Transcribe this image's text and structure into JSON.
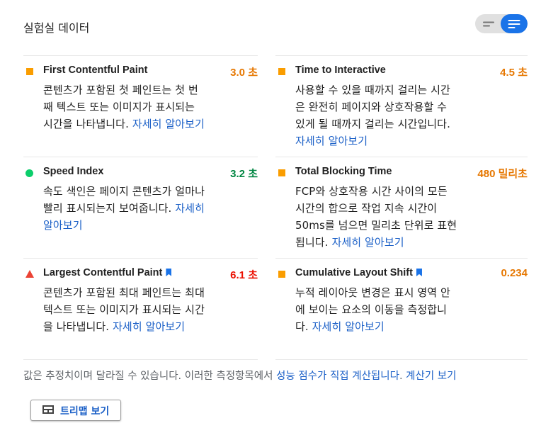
{
  "section_title": "실험실 데이터",
  "colors": {
    "accent": "#1a73e8",
    "pass": "#0cce6b",
    "average": "#fa9d00",
    "fail": "#eb4335",
    "link": "#1a5fc7"
  },
  "metrics": [
    {
      "name": "First Contentful Paint",
      "value": "3.0 초",
      "rating": "average",
      "icon": "orange-square-icon",
      "description": "콘텐츠가 포함된 첫 페인트는 첫 번째 텍스트 또는 이미지가 표시되는 시간을 나타냅니다.",
      "link": "자세히 알아보기"
    },
    {
      "name": "Time to Interactive",
      "value": "4.5 초",
      "rating": "average",
      "icon": "orange-square-icon",
      "description": "사용할 수 있을 때까지 걸리는 시간은 완전히 페이지와 상호작용할 수 있게 될 때까지 걸리는 시간입니다.",
      "link": "자세히 알아보기"
    },
    {
      "name": "Speed Index",
      "value": "3.2 초",
      "rating": "pass",
      "icon": "green-circle-icon",
      "description": "속도 색인은 페이지 콘텐츠가 얼마나 빨리 표시되는지 보여줍니다.",
      "link": "자세히 알아보기"
    },
    {
      "name": "Total Blocking Time",
      "value": "480 밀리초",
      "rating": "average",
      "icon": "orange-square-icon",
      "description": "FCP와 상호작용 시간 사이의 모든 시간의 합으로 작업 지속 시간이 50ms를 넘으면 밀리초 단위로 표현됩니다.",
      "link": "자세히 알아보기"
    },
    {
      "name": "Largest Contentful Paint",
      "value": "6.1 초",
      "rating": "fail",
      "icon": "red-triangle-icon",
      "description": "콘텐츠가 포함된 최대 페인트는 최대 텍스트 또는 이미지가 표시되는 시간을 나타냅니다.",
      "link": "자세히 알아보기"
    },
    {
      "name": "Cumulative Layout Shift",
      "value": "0.234",
      "rating": "average",
      "icon": "orange-square-icon",
      "description": "누적 레이아웃 변경은 표시 영역 안에 보이는 요소의 이동을 측정합니다.",
      "link": "자세히 알아보기"
    }
  ],
  "footer": {
    "text": "값은 추정치이며 달라질 수 있습니다. 이러한 측정항목에서 ",
    "link1": "성능 점수가 직접 계산됩니다",
    "sep": ". ",
    "link2": "계산기 보기"
  },
  "treemap_button": {
    "label": "트리맵 보기",
    "icon": "treemap-icon"
  }
}
